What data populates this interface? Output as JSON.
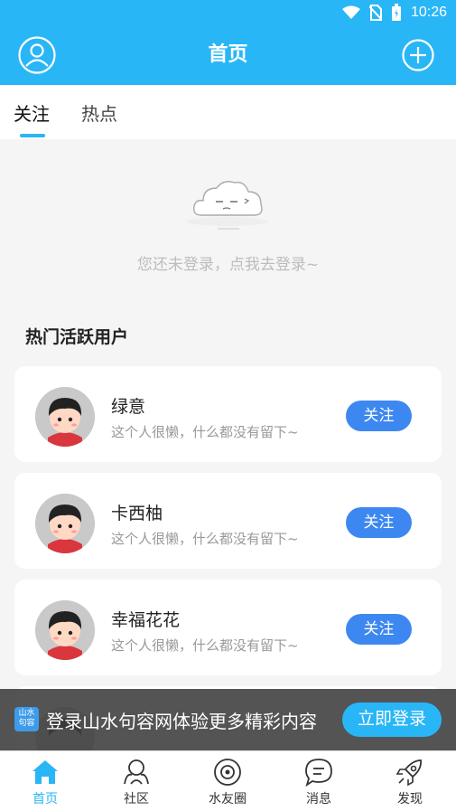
{
  "status_bar": {
    "time": "10:26"
  },
  "header": {
    "title": "首页"
  },
  "tabs": [
    {
      "label": "关注",
      "active": true
    },
    {
      "label": "热点",
      "active": false
    }
  ],
  "empty_state": {
    "message": "您还未登录，点我去登录~"
  },
  "hot_users": {
    "title": "热门活跃用户",
    "users": [
      {
        "name": "绿意",
        "bio": "这个人很懒，什么都没有留下~",
        "follow_label": "关注"
      },
      {
        "name": "卡西柚",
        "bio": "这个人很懒，什么都没有留下~",
        "follow_label": "关注"
      },
      {
        "name": "幸福花花",
        "bio": "这个人很懒，什么都没有留下~",
        "follow_label": "关注"
      }
    ]
  },
  "banner": {
    "logo_text": "山水句容",
    "message": "登录山水句容网体验更多精彩内容",
    "button": "立即登录"
  },
  "bottom_nav": [
    {
      "label": "首页",
      "icon": "home-icon",
      "active": true
    },
    {
      "label": "社区",
      "icon": "community-icon",
      "active": false
    },
    {
      "label": "水友圈",
      "icon": "circle-icon",
      "active": false
    },
    {
      "label": "消息",
      "icon": "message-icon",
      "active": false
    },
    {
      "label": "发现",
      "icon": "rocket-icon",
      "active": false
    }
  ],
  "colors": {
    "primary": "#29b6f6",
    "follow_button": "#3d88f0"
  }
}
